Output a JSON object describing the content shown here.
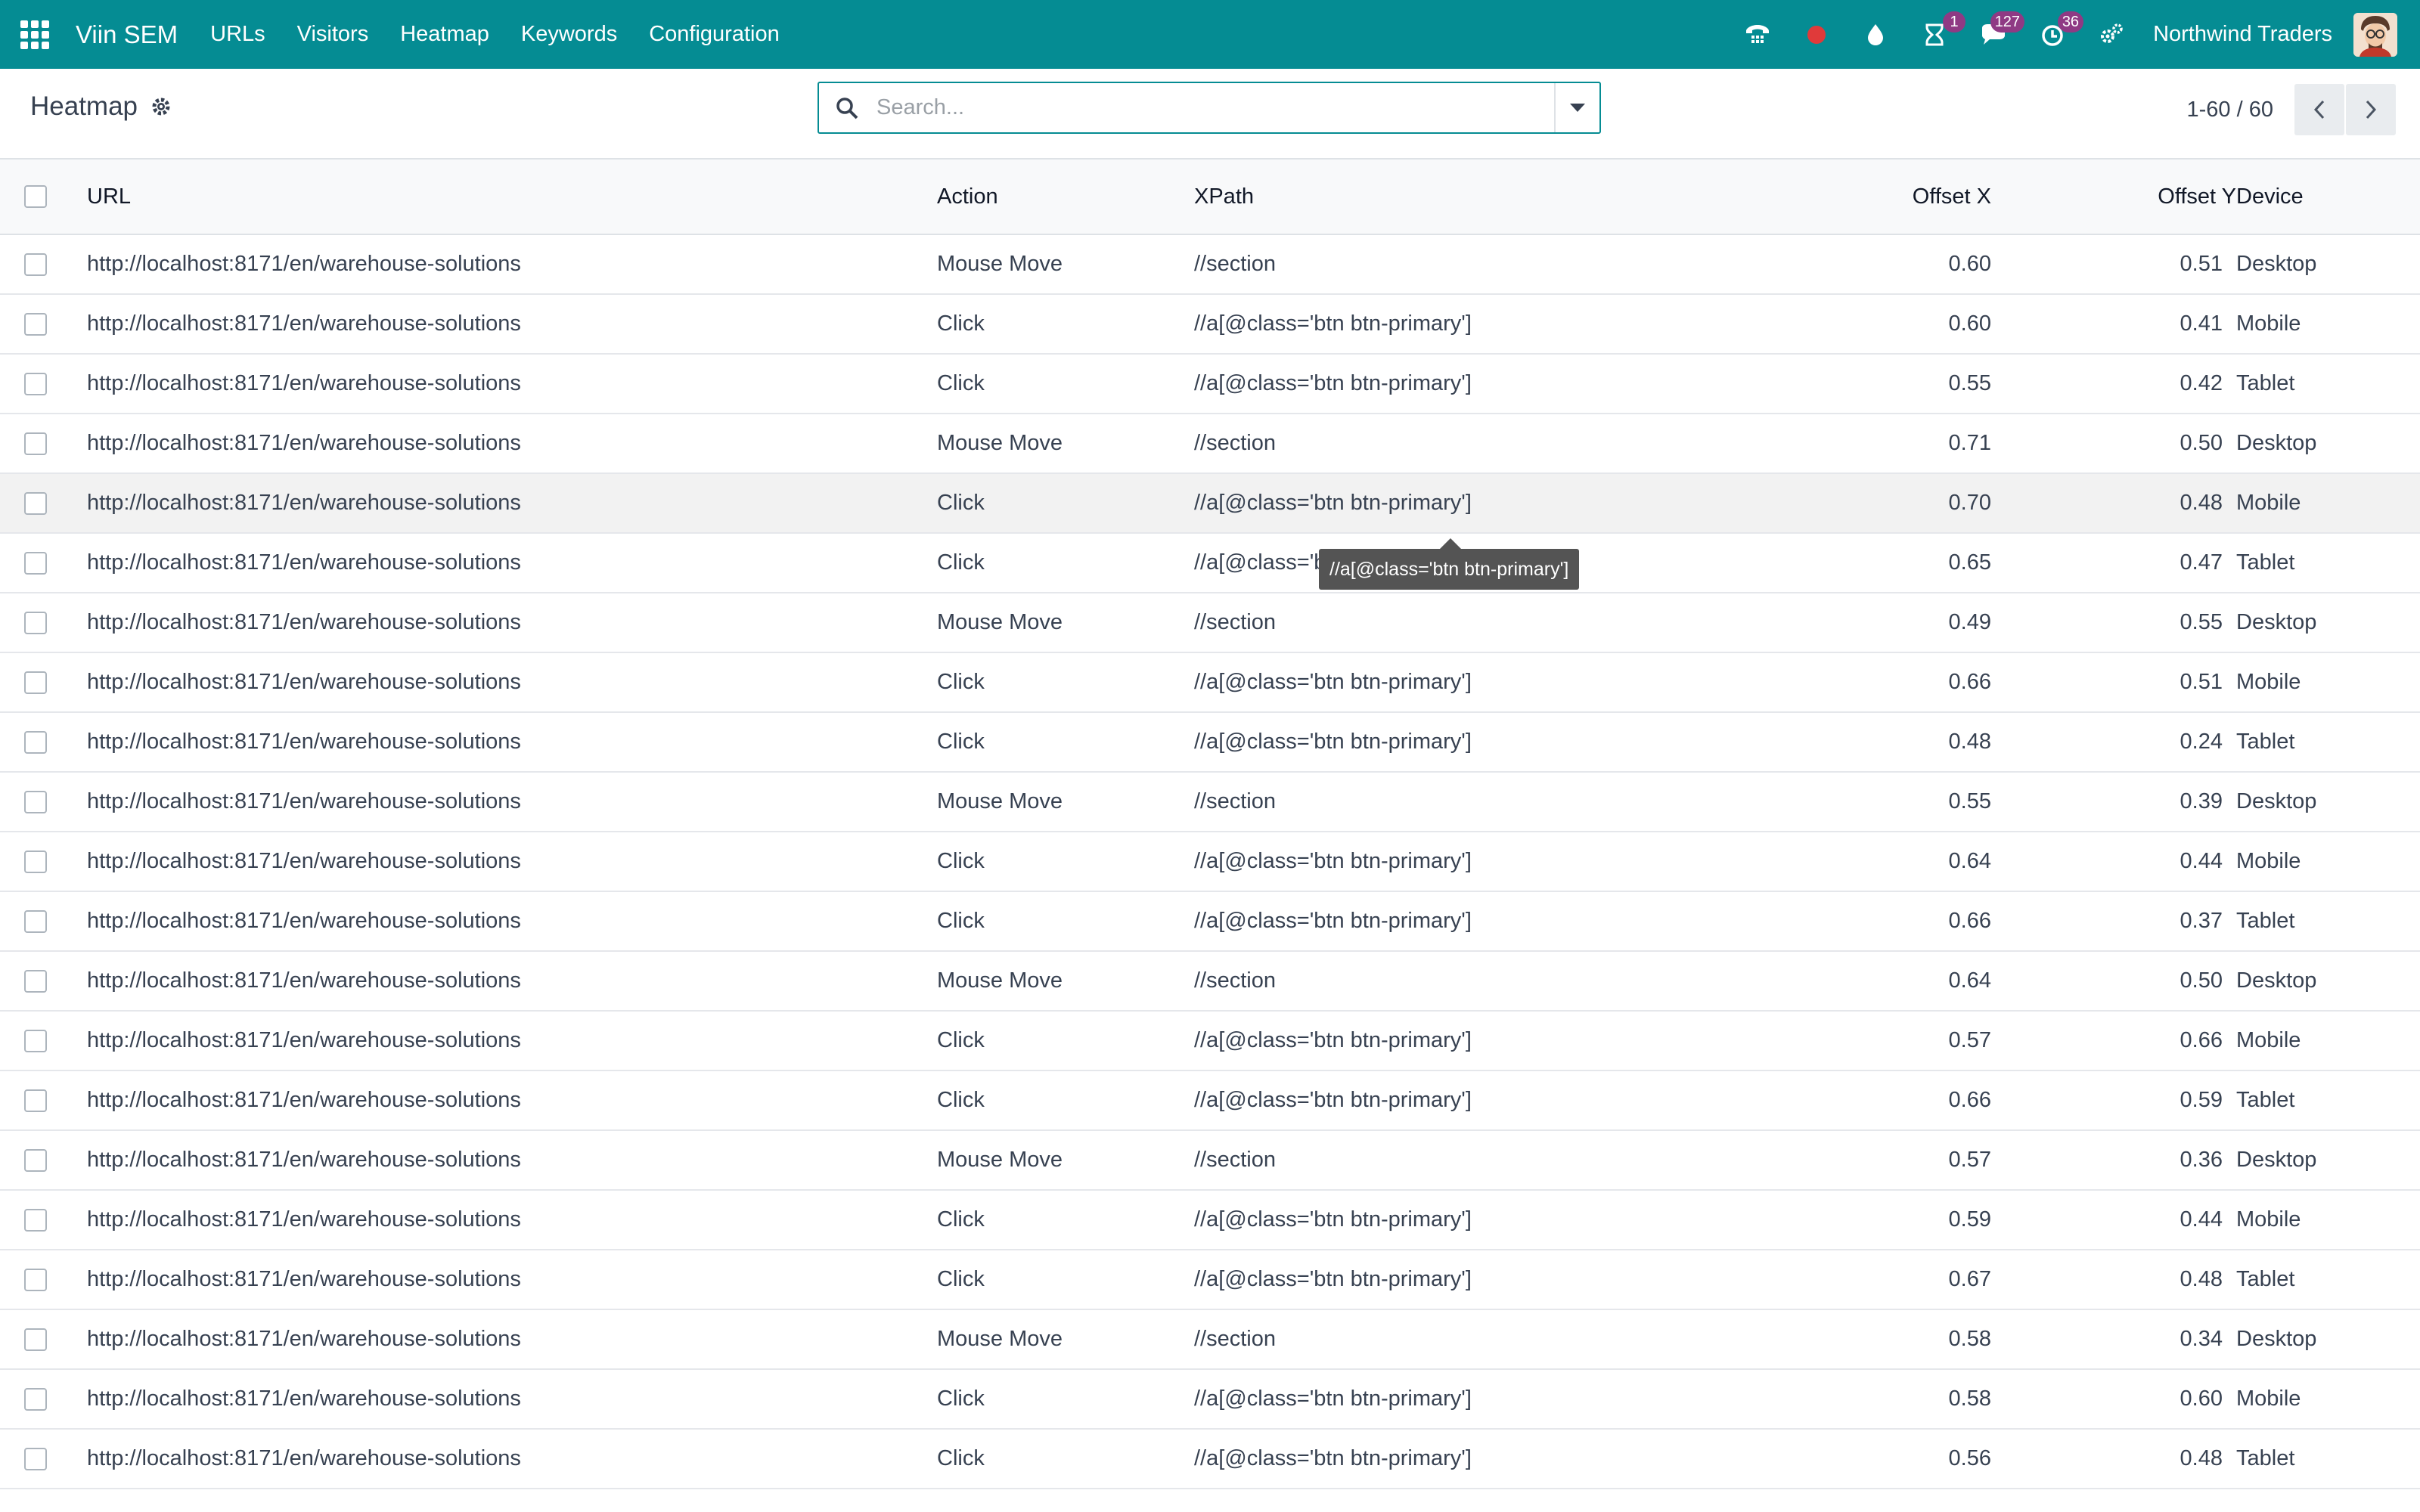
{
  "navbar": {
    "brand": "Viin SEM",
    "menu": [
      "URLs",
      "Visitors",
      "Heatmap",
      "Keywords",
      "Configuration"
    ],
    "badges": {
      "activity": "1",
      "messages": "127",
      "timer": "36"
    },
    "company": "Northwind Traders",
    "accent_color": "#058c93"
  },
  "control_panel": {
    "title": "Heatmap",
    "search_placeholder": "Search...",
    "pager": "1-60 / 60"
  },
  "table": {
    "headers": {
      "url": "URL",
      "action": "Action",
      "xpath": "XPath",
      "offset_x": "Offset X",
      "offset_y": "Offset Y",
      "device": "Device"
    },
    "rows": [
      {
        "url": "http://localhost:8171/en/warehouse-solutions",
        "action": "Mouse Move",
        "xpath": "//section",
        "ox": "0.60",
        "oy": "0.51",
        "device": "Desktop"
      },
      {
        "url": "http://localhost:8171/en/warehouse-solutions",
        "action": "Click",
        "xpath": "//a[@class='btn btn-primary']",
        "ox": "0.60",
        "oy": "0.41",
        "device": "Mobile"
      },
      {
        "url": "http://localhost:8171/en/warehouse-solutions",
        "action": "Click",
        "xpath": "//a[@class='btn btn-primary']",
        "ox": "0.55",
        "oy": "0.42",
        "device": "Tablet"
      },
      {
        "url": "http://localhost:8171/en/warehouse-solutions",
        "action": "Mouse Move",
        "xpath": "//section",
        "ox": "0.71",
        "oy": "0.50",
        "device": "Desktop"
      },
      {
        "url": "http://localhost:8171/en/warehouse-solutions",
        "action": "Click",
        "xpath": "//a[@class='btn btn-primary']",
        "ox": "0.70",
        "oy": "0.48",
        "device": "Mobile"
      },
      {
        "url": "http://localhost:8171/en/warehouse-solutions",
        "action": "Click",
        "xpath": "//a[@class='btn btn-primary']",
        "ox": "0.65",
        "oy": "0.47",
        "device": "Tablet"
      },
      {
        "url": "http://localhost:8171/en/warehouse-solutions",
        "action": "Mouse Move",
        "xpath": "//section",
        "ox": "0.49",
        "oy": "0.55",
        "device": "Desktop"
      },
      {
        "url": "http://localhost:8171/en/warehouse-solutions",
        "action": "Click",
        "xpath": "//a[@class='btn btn-primary']",
        "ox": "0.66",
        "oy": "0.51",
        "device": "Mobile"
      },
      {
        "url": "http://localhost:8171/en/warehouse-solutions",
        "action": "Click",
        "xpath": "//a[@class='btn btn-primary']",
        "ox": "0.48",
        "oy": "0.24",
        "device": "Tablet"
      },
      {
        "url": "http://localhost:8171/en/warehouse-solutions",
        "action": "Mouse Move",
        "xpath": "//section",
        "ox": "0.55",
        "oy": "0.39",
        "device": "Desktop"
      },
      {
        "url": "http://localhost:8171/en/warehouse-solutions",
        "action": "Click",
        "xpath": "//a[@class='btn btn-primary']",
        "ox": "0.64",
        "oy": "0.44",
        "device": "Mobile"
      },
      {
        "url": "http://localhost:8171/en/warehouse-solutions",
        "action": "Click",
        "xpath": "//a[@class='btn btn-primary']",
        "ox": "0.66",
        "oy": "0.37",
        "device": "Tablet"
      },
      {
        "url": "http://localhost:8171/en/warehouse-solutions",
        "action": "Mouse Move",
        "xpath": "//section",
        "ox": "0.64",
        "oy": "0.50",
        "device": "Desktop"
      },
      {
        "url": "http://localhost:8171/en/warehouse-solutions",
        "action": "Click",
        "xpath": "//a[@class='btn btn-primary']",
        "ox": "0.57",
        "oy": "0.66",
        "device": "Mobile"
      },
      {
        "url": "http://localhost:8171/en/warehouse-solutions",
        "action": "Click",
        "xpath": "//a[@class='btn btn-primary']",
        "ox": "0.66",
        "oy": "0.59",
        "device": "Tablet"
      },
      {
        "url": "http://localhost:8171/en/warehouse-solutions",
        "action": "Mouse Move",
        "xpath": "//section",
        "ox": "0.57",
        "oy": "0.36",
        "device": "Desktop"
      },
      {
        "url": "http://localhost:8171/en/warehouse-solutions",
        "action": "Click",
        "xpath": "//a[@class='btn btn-primary']",
        "ox": "0.59",
        "oy": "0.44",
        "device": "Mobile"
      },
      {
        "url": "http://localhost:8171/en/warehouse-solutions",
        "action": "Click",
        "xpath": "//a[@class='btn btn-primary']",
        "ox": "0.67",
        "oy": "0.48",
        "device": "Tablet"
      },
      {
        "url": "http://localhost:8171/en/warehouse-solutions",
        "action": "Mouse Move",
        "xpath": "//section",
        "ox": "0.58",
        "oy": "0.34",
        "device": "Desktop"
      },
      {
        "url": "http://localhost:8171/en/warehouse-solutions",
        "action": "Click",
        "xpath": "//a[@class='btn btn-primary']",
        "ox": "0.58",
        "oy": "0.60",
        "device": "Mobile"
      },
      {
        "url": "http://localhost:8171/en/warehouse-solutions",
        "action": "Click",
        "xpath": "//a[@class='btn btn-primary']",
        "ox": "0.56",
        "oy": "0.48",
        "device": "Tablet"
      }
    ]
  },
  "tooltip": "//a[@class='btn btn-primary']"
}
